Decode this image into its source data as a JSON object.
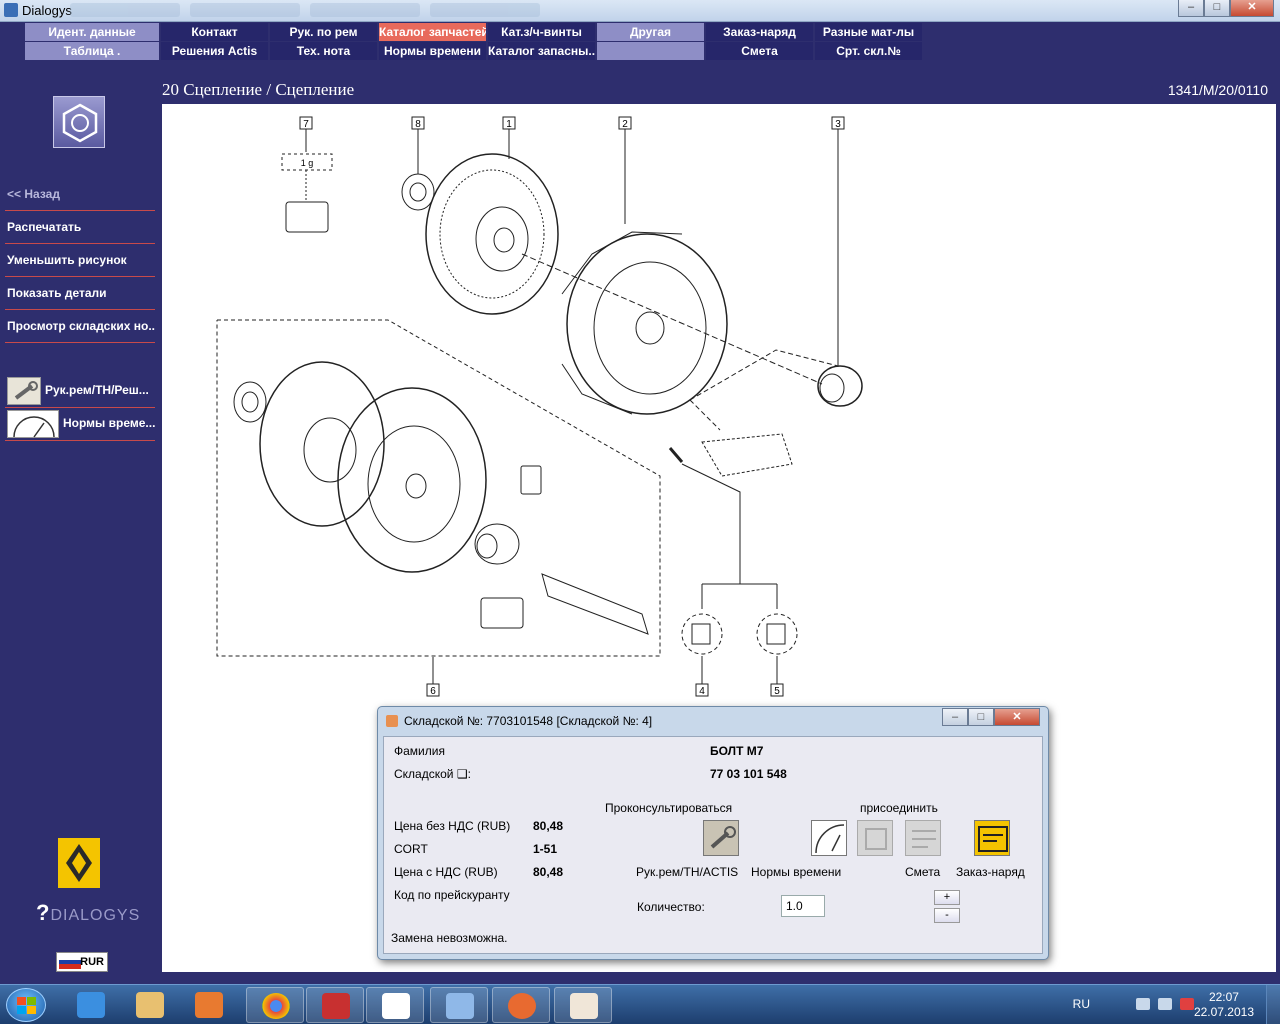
{
  "window": {
    "title": "Dialogys",
    "controls": {
      "minimize": "–",
      "maximize": "□",
      "close": "✕"
    }
  },
  "menu": {
    "row1": [
      "Идент. данные",
      "Контакт",
      "Рук. по рем",
      "Каталог запчастей",
      "Кат.з/ч-винты",
      "Другая",
      "Заказ-наряд",
      "Разные мат-лы"
    ],
    "row2": [
      "Таблица .",
      "Решения Actis",
      "Тех. нота",
      "Нормы времени",
      "Каталог запасны...",
      "",
      "Смета",
      "Срт. скл.№"
    ]
  },
  "header": {
    "title": "20 Сцепление / Сцепление",
    "ref": "1341/M/20/0110"
  },
  "sidebar": {
    "items": [
      "<< Назад",
      "Распечатать",
      "Уменьшить рисунок",
      "Показать детали",
      "Просмотр складских но..."
    ],
    "links": [
      "Рук.рем/ТН/Реш...",
      "Нормы време..."
    ],
    "brand": "DIALOGYS",
    "currency": "RUR"
  },
  "diagram": {
    "callouts": [
      "7",
      "8",
      "1",
      "2",
      "3",
      "6",
      "4",
      "5"
    ],
    "tag_label": "1 g"
  },
  "dialog": {
    "title": "Складской №: 7703101548 [Складской №: 4]",
    "family_label": "Фамилия",
    "family_value": "БОЛТ M7",
    "stock_label": "Складской ❑:",
    "stock_value": "77 03 101 548",
    "price_net_label": "Цена без НДС (RUB)",
    "price_net_value": "80,48",
    "cort_label": "CORT",
    "cort_value": "1-51",
    "price_vat_label": "Цена с НДС (RUB)",
    "price_vat_value": "80,48",
    "pricelist_label": "Код по прейскуранту",
    "consult_label": "Проконсультироваться",
    "attach_label": "присоединить",
    "icon_labels": [
      "Рук.рем/ТН/ACTIS",
      "Нормы времени",
      "Смета",
      "Заказ-наряд"
    ],
    "quantity_label": "Количество:",
    "quantity_value": "1.0",
    "plus": "+",
    "minus": "-",
    "replacement_note": "Замена невозможна."
  },
  "taskbar": {
    "lang": "RU",
    "time": "22:07",
    "date": "22.07.2013"
  },
  "colors": {
    "background": "#2e2e6e",
    "menu_light": "#8e8ec6",
    "menu_active": "#e86a5c",
    "divider": "#c84a4a"
  }
}
